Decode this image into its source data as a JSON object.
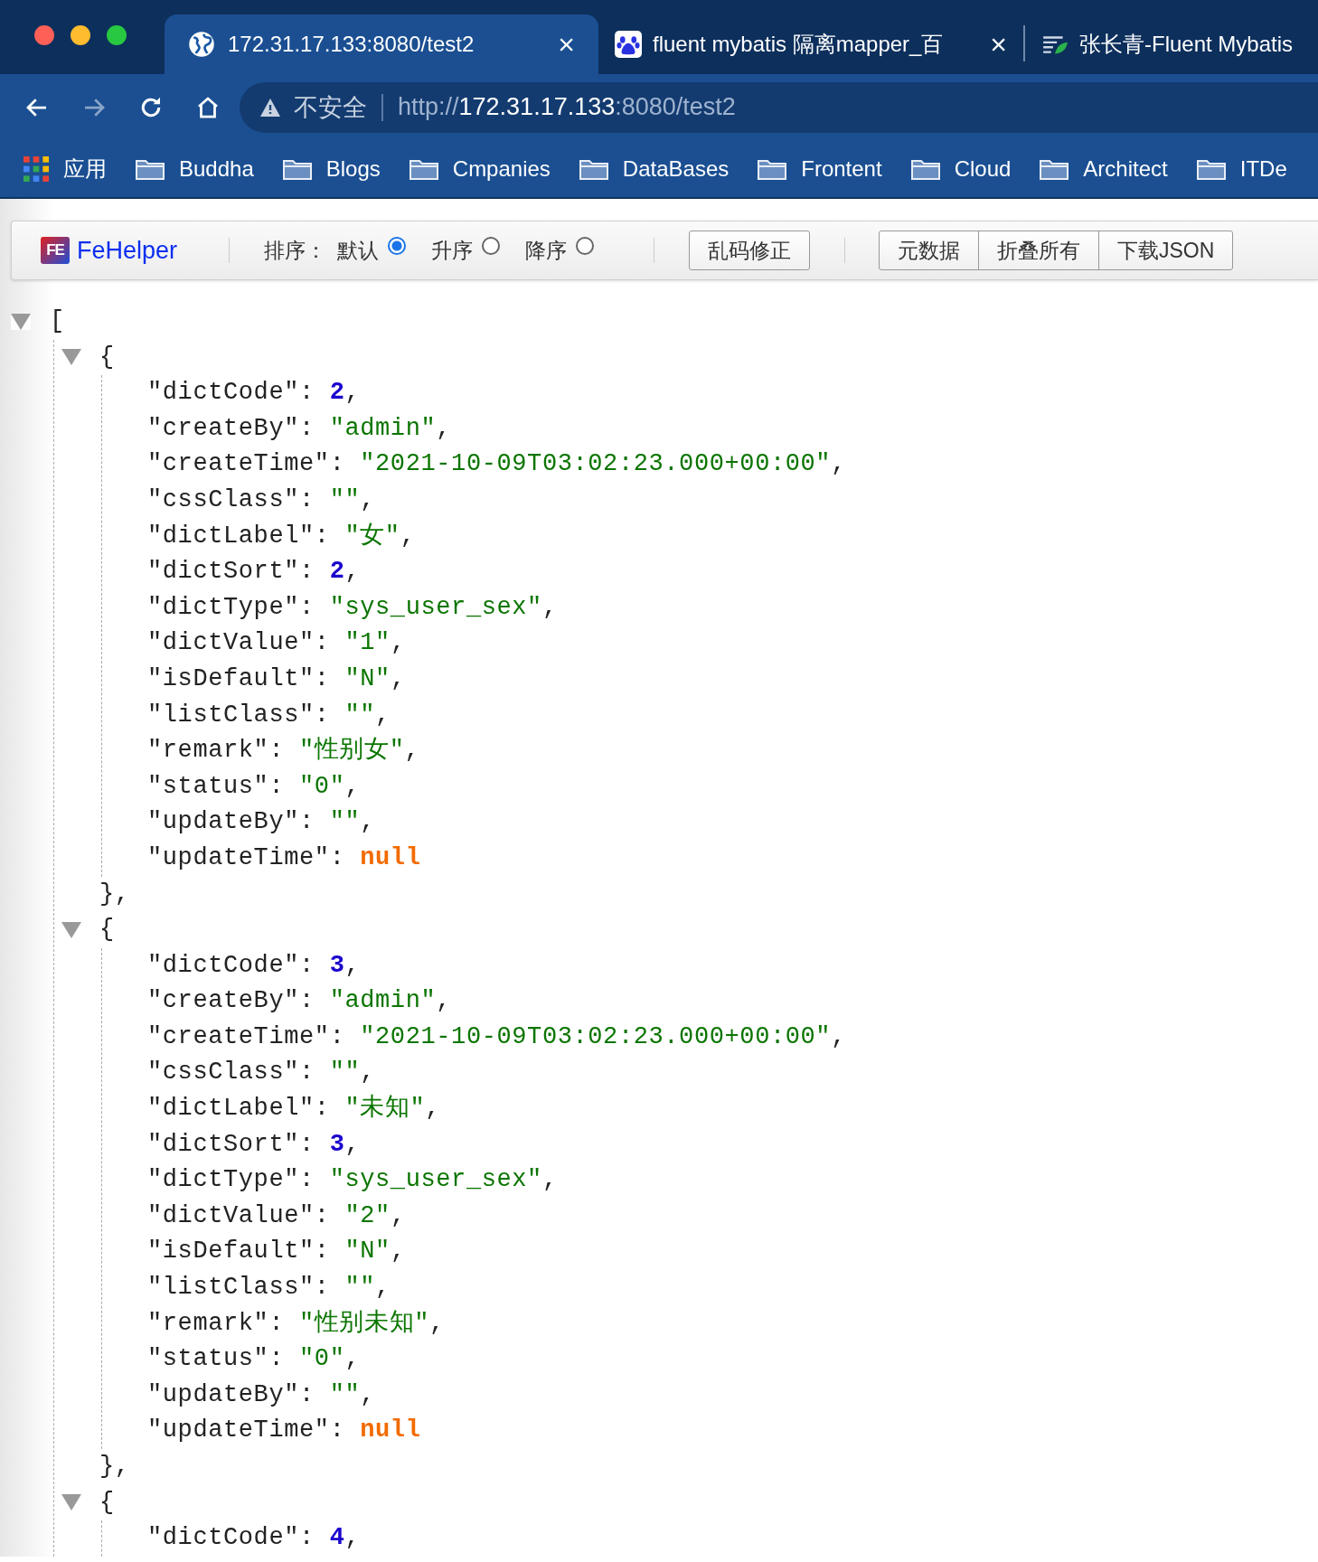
{
  "tabs": [
    {
      "title": "172.31.17.133:8080/test2",
      "kind": "globe",
      "close": "×",
      "selected": true
    },
    {
      "title": "fluent mybatis 隔离mapper_百",
      "kind": "paw",
      "close": "×",
      "selected": false
    },
    {
      "title": "张长青-Fluent Mybatis",
      "kind": "leaf",
      "selected": false
    }
  ],
  "address": {
    "warning": "不安全",
    "scheme": "http://",
    "host": "172.31.17.133",
    "rest": ":8080/test2"
  },
  "bookmarks": [
    {
      "label": "应用",
      "kind": "apps"
    },
    {
      "label": "Buddha",
      "kind": "folder"
    },
    {
      "label": "Blogs",
      "kind": "folder"
    },
    {
      "label": "Cmpanies",
      "kind": "folder"
    },
    {
      "label": "DataBases",
      "kind": "folder"
    },
    {
      "label": "Frontent",
      "kind": "folder"
    },
    {
      "label": "Cloud",
      "kind": "folder"
    },
    {
      "label": "Architect",
      "kind": "folder"
    },
    {
      "label": "ITDe",
      "kind": "folder"
    }
  ],
  "fehelper": {
    "brand": "FeHelper",
    "logo": "FE",
    "sort_label": "排序：",
    "sort_options": [
      {
        "label": "默认",
        "selected": true
      },
      {
        "label": "升序",
        "selected": false
      },
      {
        "label": "降序",
        "selected": false
      }
    ],
    "fix_button": "乱码修正",
    "buttons": [
      "元数据",
      "折叠所有",
      "下载JSON"
    ]
  },
  "json": {
    "open": "[",
    "expanded": true,
    "items": [
      {
        "open": "{",
        "close": "},",
        "expanded": true,
        "fields": [
          {
            "key": "\"dictCode\"",
            "colon": ":",
            "value": "2",
            "kind": "number",
            "sep": ","
          },
          {
            "key": "\"createBy\"",
            "colon": ":",
            "value": "\"admin\"",
            "kind": "string",
            "sep": ","
          },
          {
            "key": "\"createTime\"",
            "colon": ":",
            "value": "\"2021-10-09T03:02:23.000+00:00\"",
            "kind": "string",
            "sep": ","
          },
          {
            "key": "\"cssClass\"",
            "colon": ":",
            "value": "\"\"",
            "kind": "string",
            "sep": ","
          },
          {
            "key": "\"dictLabel\"",
            "colon": ":",
            "value": "\"女\"",
            "kind": "string",
            "sep": ","
          },
          {
            "key": "\"dictSort\"",
            "colon": ":",
            "value": "2",
            "kind": "number",
            "sep": ","
          },
          {
            "key": "\"dictType\"",
            "colon": ":",
            "value": "\"sys_user_sex\"",
            "kind": "string",
            "sep": ","
          },
          {
            "key": "\"dictValue\"",
            "colon": ":",
            "value": "\"1\"",
            "kind": "string",
            "sep": ","
          },
          {
            "key": "\"isDefault\"",
            "colon": ":",
            "value": "\"N\"",
            "kind": "string",
            "sep": ","
          },
          {
            "key": "\"listClass\"",
            "colon": ":",
            "value": "\"\"",
            "kind": "string",
            "sep": ","
          },
          {
            "key": "\"remark\"",
            "colon": ":",
            "value": "\"性别女\"",
            "kind": "string",
            "sep": ","
          },
          {
            "key": "\"status\"",
            "colon": ":",
            "value": "\"0\"",
            "kind": "string",
            "sep": ","
          },
          {
            "key": "\"updateBy\"",
            "colon": ":",
            "value": "\"\"",
            "kind": "string",
            "sep": ","
          },
          {
            "key": "\"updateTime\"",
            "colon": ":",
            "value": "null",
            "kind": "null"
          }
        ]
      },
      {
        "open": "{",
        "close": "},",
        "expanded": true,
        "fields": [
          {
            "key": "\"dictCode\"",
            "colon": ":",
            "value": "3",
            "kind": "number",
            "sep": ","
          },
          {
            "key": "\"createBy\"",
            "colon": ":",
            "value": "\"admin\"",
            "kind": "string",
            "sep": ","
          },
          {
            "key": "\"createTime\"",
            "colon": ":",
            "value": "\"2021-10-09T03:02:23.000+00:00\"",
            "kind": "string",
            "sep": ","
          },
          {
            "key": "\"cssClass\"",
            "colon": ":",
            "value": "\"\"",
            "kind": "string",
            "sep": ","
          },
          {
            "key": "\"dictLabel\"",
            "colon": ":",
            "value": "\"未知\"",
            "kind": "string",
            "sep": ","
          },
          {
            "key": "\"dictSort\"",
            "colon": ":",
            "value": "3",
            "kind": "number",
            "sep": ","
          },
          {
            "key": "\"dictType\"",
            "colon": ":",
            "value": "\"sys_user_sex\"",
            "kind": "string",
            "sep": ","
          },
          {
            "key": "\"dictValue\"",
            "colon": ":",
            "value": "\"2\"",
            "kind": "string",
            "sep": ","
          },
          {
            "key": "\"isDefault\"",
            "colon": ":",
            "value": "\"N\"",
            "kind": "string",
            "sep": ","
          },
          {
            "key": "\"listClass\"",
            "colon": ":",
            "value": "\"\"",
            "kind": "string",
            "sep": ","
          },
          {
            "key": "\"remark\"",
            "colon": ":",
            "value": "\"性别未知\"",
            "kind": "string",
            "sep": ","
          },
          {
            "key": "\"status\"",
            "colon": ":",
            "value": "\"0\"",
            "kind": "string",
            "sep": ","
          },
          {
            "key": "\"updateBy\"",
            "colon": ":",
            "value": "\"\"",
            "kind": "string",
            "sep": ","
          },
          {
            "key": "\"updateTime\"",
            "colon": ":",
            "value": "null",
            "kind": "null"
          }
        ]
      },
      {
        "open": "{",
        "expanded": true,
        "fields": [
          {
            "key": "\"dictCode\"",
            "colon": ":",
            "value": "4",
            "kind": "number",
            "sep": ","
          }
        ]
      }
    ]
  }
}
